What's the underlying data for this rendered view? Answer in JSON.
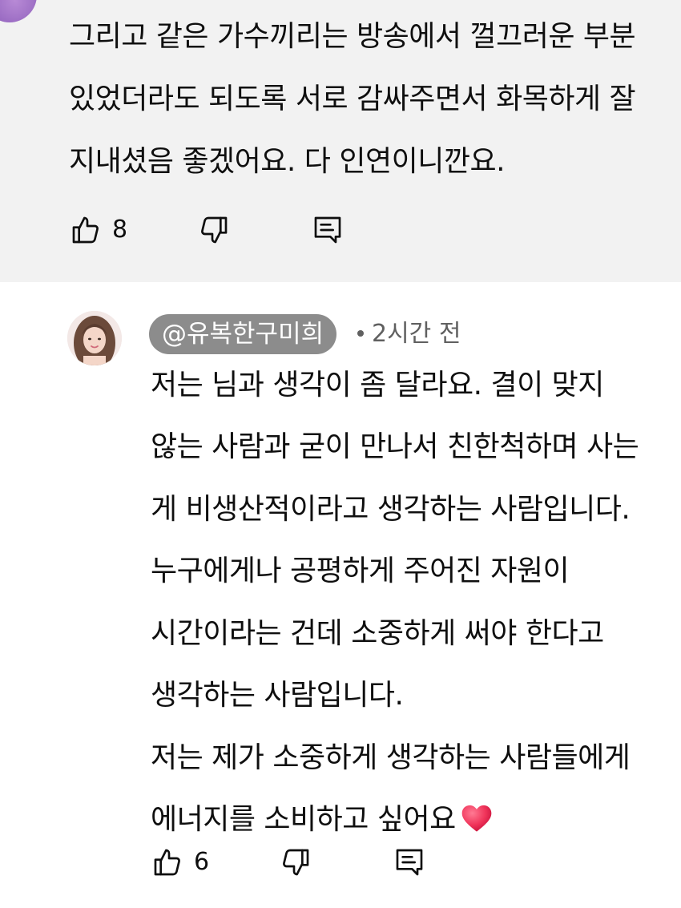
{
  "comments": [
    {
      "body_lines": [
        "그리고 같은 가수끼리는 방송에서 껄끄러운 부분",
        "있었더라도 되도록 서로 감싸주면서 화목하게 잘",
        "지내셨음 좋겠어요. 다 인연이니깐요."
      ],
      "likes": "8"
    },
    {
      "handle": "@유복한구미희",
      "time": "2시간 전",
      "body_lines": [
        "저는 님과 생각이 좀 달라요. 결이 맞지",
        "않는 사람과 굳이 만나서 친한척하며 사는",
        "게 비생산적이라고 생각하는 사람입니다.",
        "누구에게나 공평하게 주어진 자원이",
        "시간이라는 건데 소중하게 써야 한다고",
        "생각하는 사람입니다.",
        "저는 제가 소중하게 생각하는 사람들에게",
        "에너지를 소비하고 싶어요"
      ],
      "likes": "6",
      "emoji": "heart"
    }
  ],
  "icons": {
    "like": "thumbs-up-icon",
    "dislike": "thumbs-down-icon",
    "reply": "reply-comment-icon",
    "heart": "red-heart-emoji"
  },
  "colors": {
    "highlight_bg": "#f2f2f2",
    "handle_chip": "#8c8c8c",
    "meta_text": "#606060",
    "heart": "#f0345a"
  }
}
